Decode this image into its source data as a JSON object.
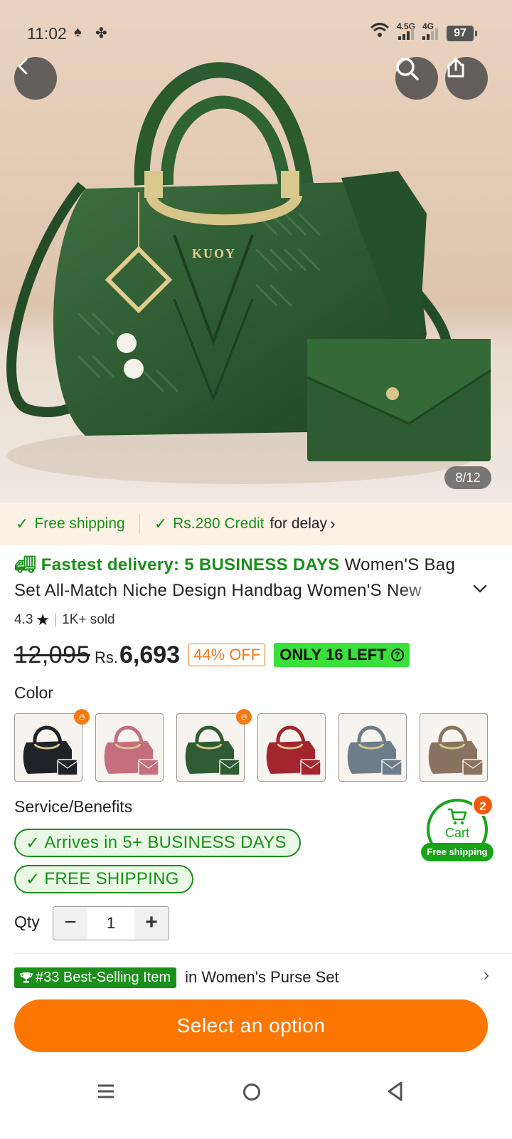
{
  "status": {
    "time": "11:02",
    "net1": "4.5G",
    "net2": "4G",
    "battery": "97"
  },
  "hero": {
    "counter": "8/12",
    "brand_text": "KUOY"
  },
  "shipping_banner": {
    "free_shipping": "Free shipping",
    "credit": "Rs.280 Credit",
    "credit_suffix": "for delay"
  },
  "product": {
    "fast_delivery": "Fastest delivery: 5 BUSINESS DAYS",
    "title": "Women'S Bag Set All-Match Niche Design Handbag Women'S New",
    "rating": "4.3",
    "sold": "1K+ sold",
    "old_price": "12,095",
    "currency": "Rs.",
    "price": "6,693",
    "discount": "44% OFF",
    "stock": "ONLY 16 LEFT"
  },
  "color": {
    "label": "Color",
    "options": [
      {
        "name": "black",
        "color": "#1e2328",
        "hot": true
      },
      {
        "name": "pink",
        "color": "#c46e7e",
        "hot": false
      },
      {
        "name": "green",
        "color": "#2f5c32",
        "hot": true
      },
      {
        "name": "red",
        "color": "#a3262f",
        "hot": false
      },
      {
        "name": "gray-blue",
        "color": "#6d7d8a",
        "hot": false
      },
      {
        "name": "khaki",
        "color": "#8a7260",
        "hot": false
      }
    ]
  },
  "service": {
    "label": "Service/Benefits",
    "arrives": "Arrives in 5+ BUSINESS DAYS",
    "free_shipping": "FREE SHIPPING"
  },
  "cart": {
    "label": "Cart",
    "badge": "Free shipping",
    "count": "2"
  },
  "qty": {
    "label": "Qty",
    "value": "1",
    "minus": "−",
    "plus": "+"
  },
  "best_selling": {
    "badge": "#33 Best-Selling Item",
    "text": "in Women's Purse Set"
  },
  "cta": {
    "label": "Select an option"
  },
  "colors": {
    "accent": "#fb7701",
    "green": "#1a8f1a",
    "bag": "#2f5c32"
  }
}
